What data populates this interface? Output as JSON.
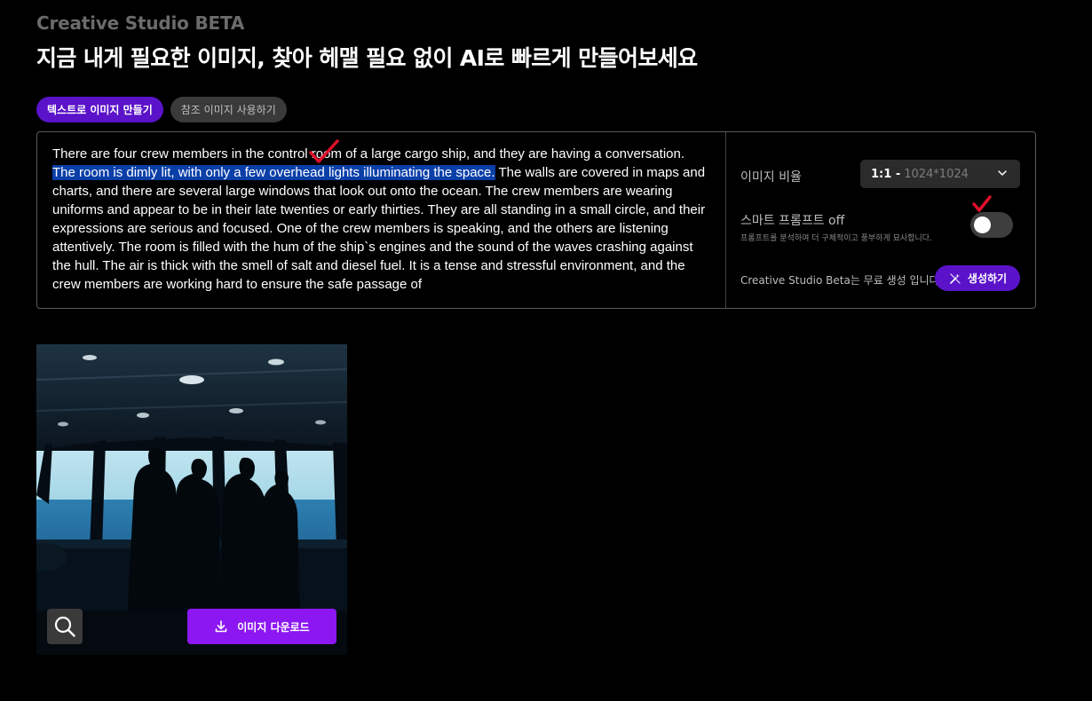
{
  "header": {
    "brand": "Creative Studio BETA",
    "headline": "지금 내게 필요한 이미지, 찾아 헤맬 필요 없이 AI로 빠르게 만들어보세요"
  },
  "tabs": [
    {
      "label": "텍스트로 이미지 만들기",
      "active": true
    },
    {
      "label": "참조 이미지 사용하기",
      "active": false
    }
  ],
  "prompt": {
    "text_before": "There are four crew members in the control room of a large cargo ship, and they are having a conversation. ",
    "text_highlighted": "The room is dimly lit, with only a few overhead lights illuminating the space.",
    "text_after": " The walls are covered in maps and charts, and there are several large windows that look out onto the ocean. The crew members are wearing uniforms and appear to be in their late twenties or early thirties. They are all standing in a small circle, and their expressions are serious and focused. One of the crew members is speaking, and the others are listening attentively. The room is filled with the hum of the ship`s engines and the sound of the waves crashing against the hull. The air is thick with the smell of salt and diesel fuel. It is a tense and stressful environment, and the crew members are working hard to ensure the safe passage of"
  },
  "settings": {
    "ratio_label": "이미지 비율",
    "ratio_value": "1:1 -",
    "ratio_size": "1024*1024",
    "smart_prompt_label": "스마트 프롬프트  off",
    "smart_prompt_desc": "프롬프트를 분석하여 더 구체적이고 풍부하게 묘사합니다.",
    "smart_prompt_on": false,
    "free_text": "Creative Studio Beta는 무료 생성 입니다.",
    "generate_label": "생성하기"
  },
  "result": {
    "download_label": "이미지 다운로드"
  },
  "colors": {
    "accent": "#5a13c9",
    "download": "#8c17f2",
    "highlight": "#0b3fa8",
    "checkmark": "#e0102a"
  },
  "icons": {
    "chevron": "chevron-down-icon",
    "generate": "magic-wand-icon",
    "zoom": "search-icon",
    "download": "download-icon"
  }
}
